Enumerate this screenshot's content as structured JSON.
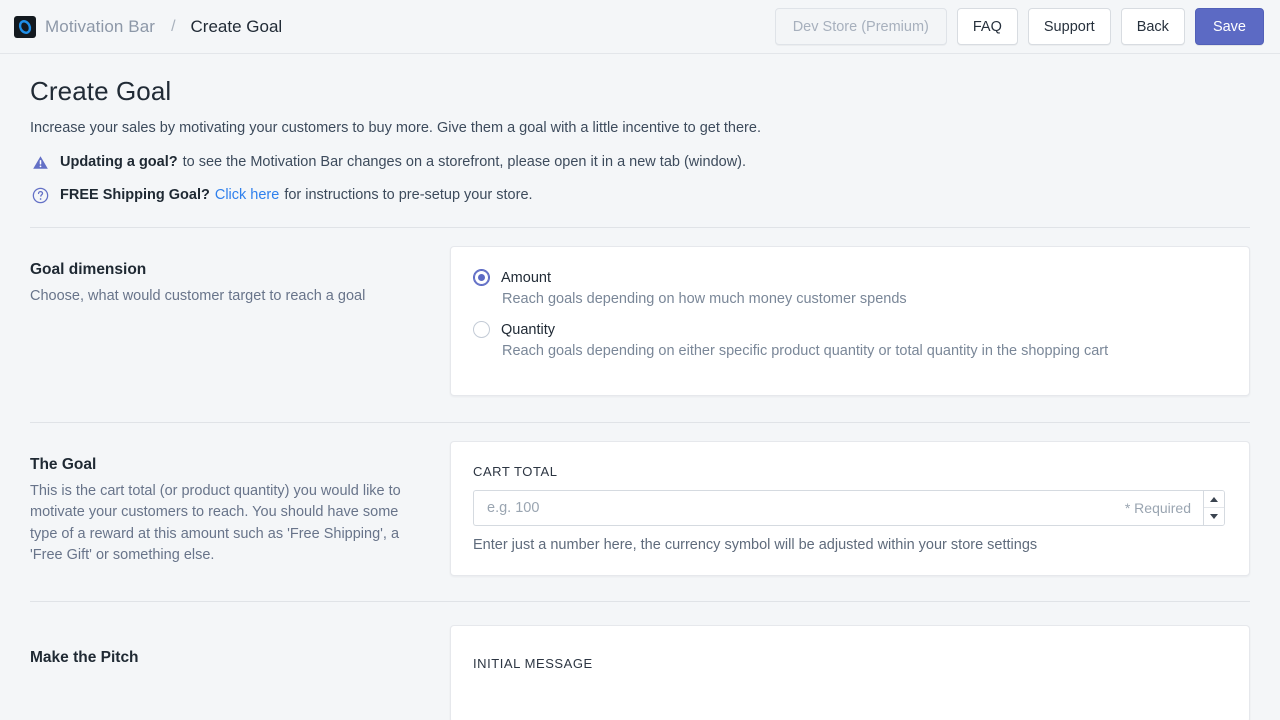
{
  "topbar": {
    "logo_icon": "motivation-bar-logo-icon",
    "brand": "Motivation Bar",
    "separator": "/",
    "page": "Create Goal",
    "buttons": {
      "store": "Dev Store (Premium)",
      "faq": "FAQ",
      "support": "Support",
      "back": "Back",
      "save": "Save"
    }
  },
  "colors": {
    "accent": "#5c6ac4",
    "link": "#2f80ed",
    "page_bg": "#f4f6f8",
    "card_bg": "#ffffff",
    "border": "#e6e8ec"
  },
  "page": {
    "title": "Create Goal",
    "subtitle": "Increase your sales by motivating your customers to buy more. Give them a goal with a little incentive to get there.",
    "notices": [
      {
        "icon": "warning-triangle-icon",
        "strong": "Updating a goal?",
        "text": "to see the Motivation Bar changes on a storefront, please open it in a new tab (window)."
      },
      {
        "icon": "question-circle-icon",
        "strong": "FREE Shipping Goal?",
        "link": "Click here",
        "text": "for instructions to pre-setup your store."
      }
    ]
  },
  "sections": [
    {
      "title": "Goal dimension",
      "desc": "Choose, what would customer target to reach a goal",
      "options": [
        {
          "label": "Amount",
          "help": "Reach goals depending on how much money customer spends",
          "selected": true
        },
        {
          "label": "Quantity",
          "help": "Reach goals depending on either specific product quantity or total quantity in the shopping cart",
          "selected": false
        }
      ]
    },
    {
      "title": "The Goal",
      "desc": "This is the cart total (or product quantity) you would like to motivate your customers to reach. You should have some type of a reward at this amount such as 'Free Shipping', a 'Free Gift' or something else.",
      "field": {
        "label": "CART TOTAL",
        "value": "",
        "placeholder": "e.g. 100",
        "required_note": "* Required",
        "help": "Enter just a number here, the currency symbol will be adjusted within your store settings",
        "spinner_up_icon": "caret-up-icon",
        "spinner_down_icon": "caret-down-icon"
      }
    },
    {
      "title": "Make the Pitch",
      "field": {
        "label": "INITIAL MESSAGE"
      }
    }
  ]
}
